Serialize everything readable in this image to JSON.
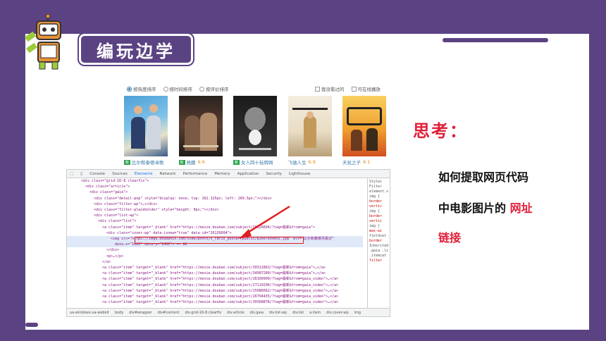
{
  "header": {
    "title": "编玩边学"
  },
  "sort_bar": {
    "options": [
      "按热度排序",
      "按时间排序",
      "按评价排序"
    ],
    "checks": [
      "我没看过的",
      "可在线播放"
    ]
  },
  "movies": [
    {
      "title": "比尔和泰德寻歌",
      "rating": "",
      "new": "新"
    },
    {
      "title": "贱籍",
      "rating": "6.6",
      "new": "新"
    },
    {
      "title": "女人四十玩转网",
      "rating": "",
      "new": "新"
    },
    {
      "title": "飞驰人生",
      "rating": "6.9",
      "new": ""
    },
    {
      "title": "天気之子",
      "rating": "8.1",
      "new": ""
    }
  ],
  "devtools": {
    "tabs": [
      "Console",
      "Sources",
      "Elements",
      "Network",
      "Performance",
      "Memory",
      "Application",
      "Security",
      "Lighthouse"
    ],
    "side_tabs": [
      "Styles",
      "Filter",
      "element.s",
      "img {",
      "border",
      "vertic",
      "img {",
      "border",
      "vertic",
      "img {",
      "max-wi",
      "fieldset",
      "border",
      "Inherited",
      ".gaia .li",
      ".itemcat",
      "filter"
    ],
    "footer_crumbs": [
      "ua-windows.ua-webkit",
      "body",
      "div#wrapper",
      "div#content",
      "div.grid-16-8.clearfix",
      "div.article",
      "div.gaia",
      "div.list-wp",
      "div.list",
      "a.item",
      "div.cover-wp",
      "img"
    ],
    "lines": [
      "<div class=\"grid-16-8 clearfix\">",
      "<div class=\"article\">",
      "<div class=\"gaia\">",
      "<div class=\"detail-pop\" style=\"display: none; top: 162.125px; left: 269.5px;\"></div>",
      "<div class=\"filter-wp\">…</div>",
      "<div class=\"filter-placeholder\" style=\"height: 0px;\"></div>",
      "<div class=\"list-wp\">",
      "<div class=\"list\">",
      "<a class=\"item\" target=\"_blank\" href=\"https://movie.douban.com/subject/26126604/?tag=最新&from=gaia\">",
      "<div class=\"cover-wp\" data-isnew=\"true\" data-id=\"26126604\">",
      "<img src=\"https://img9.doubanio.com/view/photo/s_ratio_poster/public/p2607609055.jpg\" alt=\"比尔和泰德寻歌记\"",
      "data-x=\"1620\" data-y=\"2400\"> == $0",
      "</div>",
      "<p>…</p>",
      "</a>",
      "<a class=\"item\" target=\"_blank\" href=\"https://movie.douban.com/subject/30312863/?tag=最新&from=gaia\">…</a>",
      "<a class=\"item\" target=\"_blank\" href=\"https://movie.douban.com/subject/34907280/?tag=最新&from=gaia\">…</a>",
      "<a class=\"item\" target=\"_blank\" href=\"https://movie.douban.com/subject/26160900/?tag=最新&from=gaia_video\">…</a>",
      "<a class=\"item\" target=\"_blank\" href=\"https://movie.douban.com/subject/27110296/?tag=最新&from=gaia_video\">…</a>",
      "<a class=\"item\" target=\"_blank\" href=\"https://movie.douban.com/subject/25986662/?tag=最新&from=gaia_video\">…</a>",
      "<a class=\"item\" target=\"_blank\" href=\"https://movie.douban.com/subject/26794435/?tag=最新&from=gaia_video\">…</a>",
      "<a class=\"item\" target=\"_blank\" href=\"https://movie.douban.com/subject/30368878/?tag=最新&from=gaia_video\">…</a>"
    ]
  },
  "think_label": "思考：",
  "question": {
    "line1": "如何提取网页代码",
    "line2_prefix": "中电影图片的",
    "line2_highlight": "网址",
    "line3": "链接"
  },
  "colors": {
    "purple": "#5b4383",
    "red": "#e0203a",
    "highlight_box": "#e02020"
  }
}
